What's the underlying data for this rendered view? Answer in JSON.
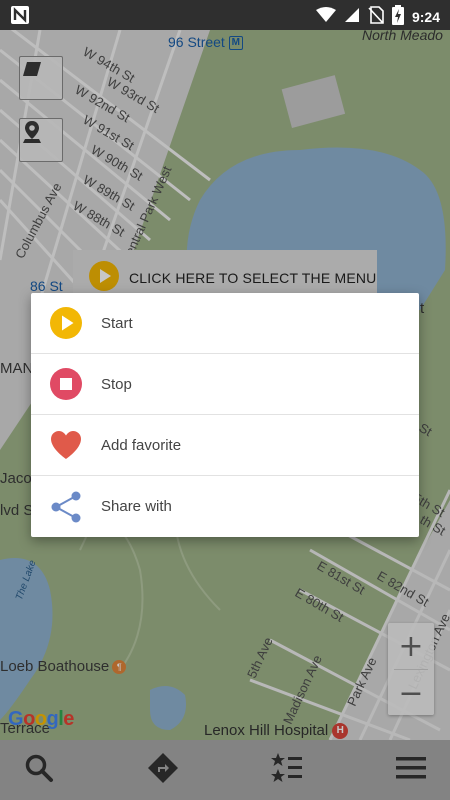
{
  "status_bar": {
    "time": "9:24",
    "icons": [
      "n-notification-icon",
      "wifi-icon",
      "signal-icon",
      "no-sim-icon",
      "battery-charging-icon"
    ]
  },
  "map": {
    "labels": {
      "w94": "W 94th St",
      "w93": "W 93rd St",
      "w92": "W 92nd St",
      "w91": "W 91st St",
      "w90": "W 90th St",
      "w89": "W 89th St",
      "w88": "W 88th St",
      "station96": "96 Street",
      "station86": "86 St",
      "north_meadow": "North Meado",
      "columbus": "Columbus Ave",
      "cpw": "Central Park West",
      "manhattan": "MAN",
      "jacob": "Jaco",
      "blvd": "lvd S",
      "terrace": "Terrace",
      "lake": "The Lake",
      "boathouse": "Loeb Boathouse",
      "hospital": "Lenox Hill Hospital",
      "fifth": "5th Ave",
      "madison": "Madison Ave",
      "park": "Park Ave",
      "lexington": "Lexington Ave",
      "e81": "E 81st St",
      "e82": "E 82nd St",
      "e80": "E 80th St",
      "st": "St",
      "st2": "5th St",
      "st3": "th St",
      "t": "t"
    },
    "google": "Google",
    "metro_letter": "M",
    "hospital_letter": "H",
    "zoom_in": "+",
    "zoom_out": "−"
  },
  "banner": {
    "label": "CLICK HERE TO SELECT THE MENU"
  },
  "menu": {
    "items": [
      {
        "label": "Start",
        "icon": "play-circle-icon",
        "color": "#f2b705"
      },
      {
        "label": "Stop",
        "icon": "stop-circle-icon",
        "color": "#e04a64"
      },
      {
        "label": "Add favorite",
        "icon": "heart-icon",
        "color": "#e05a4a"
      },
      {
        "label": "Share with",
        "icon": "share-icon",
        "color": "#6b8ac7"
      }
    ]
  },
  "bottom_bar": {
    "buttons": [
      "search-icon",
      "directions-icon",
      "favorites-list-icon",
      "menu-icon"
    ]
  }
}
